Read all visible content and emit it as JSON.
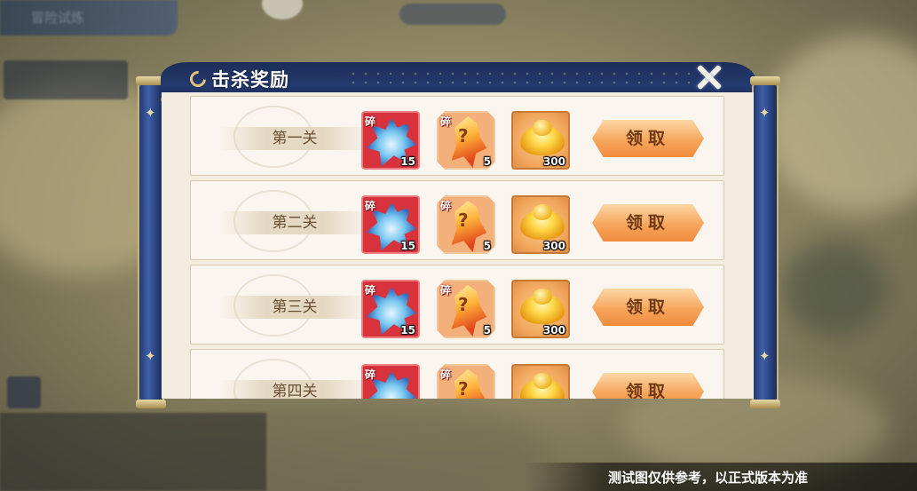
{
  "background": {
    "top_label": "冒险试炼"
  },
  "modal": {
    "title": "击杀奖励",
    "rows": [
      {
        "stage": "第一关",
        "rewards": [
          {
            "type": "shard",
            "icon": "ice-dragon-shard-icon",
            "badge": "碎",
            "qty": "15"
          },
          {
            "type": "shard",
            "icon": "mystery-shard-icon",
            "badge": "碎",
            "qty": "5"
          },
          {
            "type": "currency",
            "icon": "gold-ingot-icon",
            "qty": "300"
          }
        ],
        "button": "领取"
      },
      {
        "stage": "第二关",
        "rewards": [
          {
            "type": "shard",
            "icon": "ice-dragon-shard-icon",
            "badge": "碎",
            "qty": "15"
          },
          {
            "type": "shard",
            "icon": "mystery-shard-icon",
            "badge": "碎",
            "qty": "5"
          },
          {
            "type": "currency",
            "icon": "gold-ingot-icon",
            "qty": "300"
          }
        ],
        "button": "领取"
      },
      {
        "stage": "第三关",
        "rewards": [
          {
            "type": "shard",
            "icon": "ice-dragon-shard-icon",
            "badge": "碎",
            "qty": "15"
          },
          {
            "type": "shard",
            "icon": "mystery-shard-icon",
            "badge": "碎",
            "qty": "5"
          },
          {
            "type": "currency",
            "icon": "gold-ingot-icon",
            "qty": "300"
          }
        ],
        "button": "领取"
      },
      {
        "stage": "第四关",
        "rewards": [
          {
            "type": "shard",
            "icon": "ice-dragon-shard-icon",
            "badge": "碎",
            "qty": ""
          },
          {
            "type": "shard",
            "icon": "mystery-shard-icon",
            "badge": "碎",
            "qty": ""
          },
          {
            "type": "currency",
            "icon": "gold-ingot-icon",
            "qty": ""
          }
        ],
        "button": "领取"
      }
    ]
  },
  "watermark": "测试图仅供参考，以正式版本为准",
  "colors": {
    "banner": "#1d2d58",
    "paper": "#f3ece1",
    "button": "#f7a55c",
    "button_text": "#6e3a16",
    "stage_text": "#6b4f32"
  }
}
